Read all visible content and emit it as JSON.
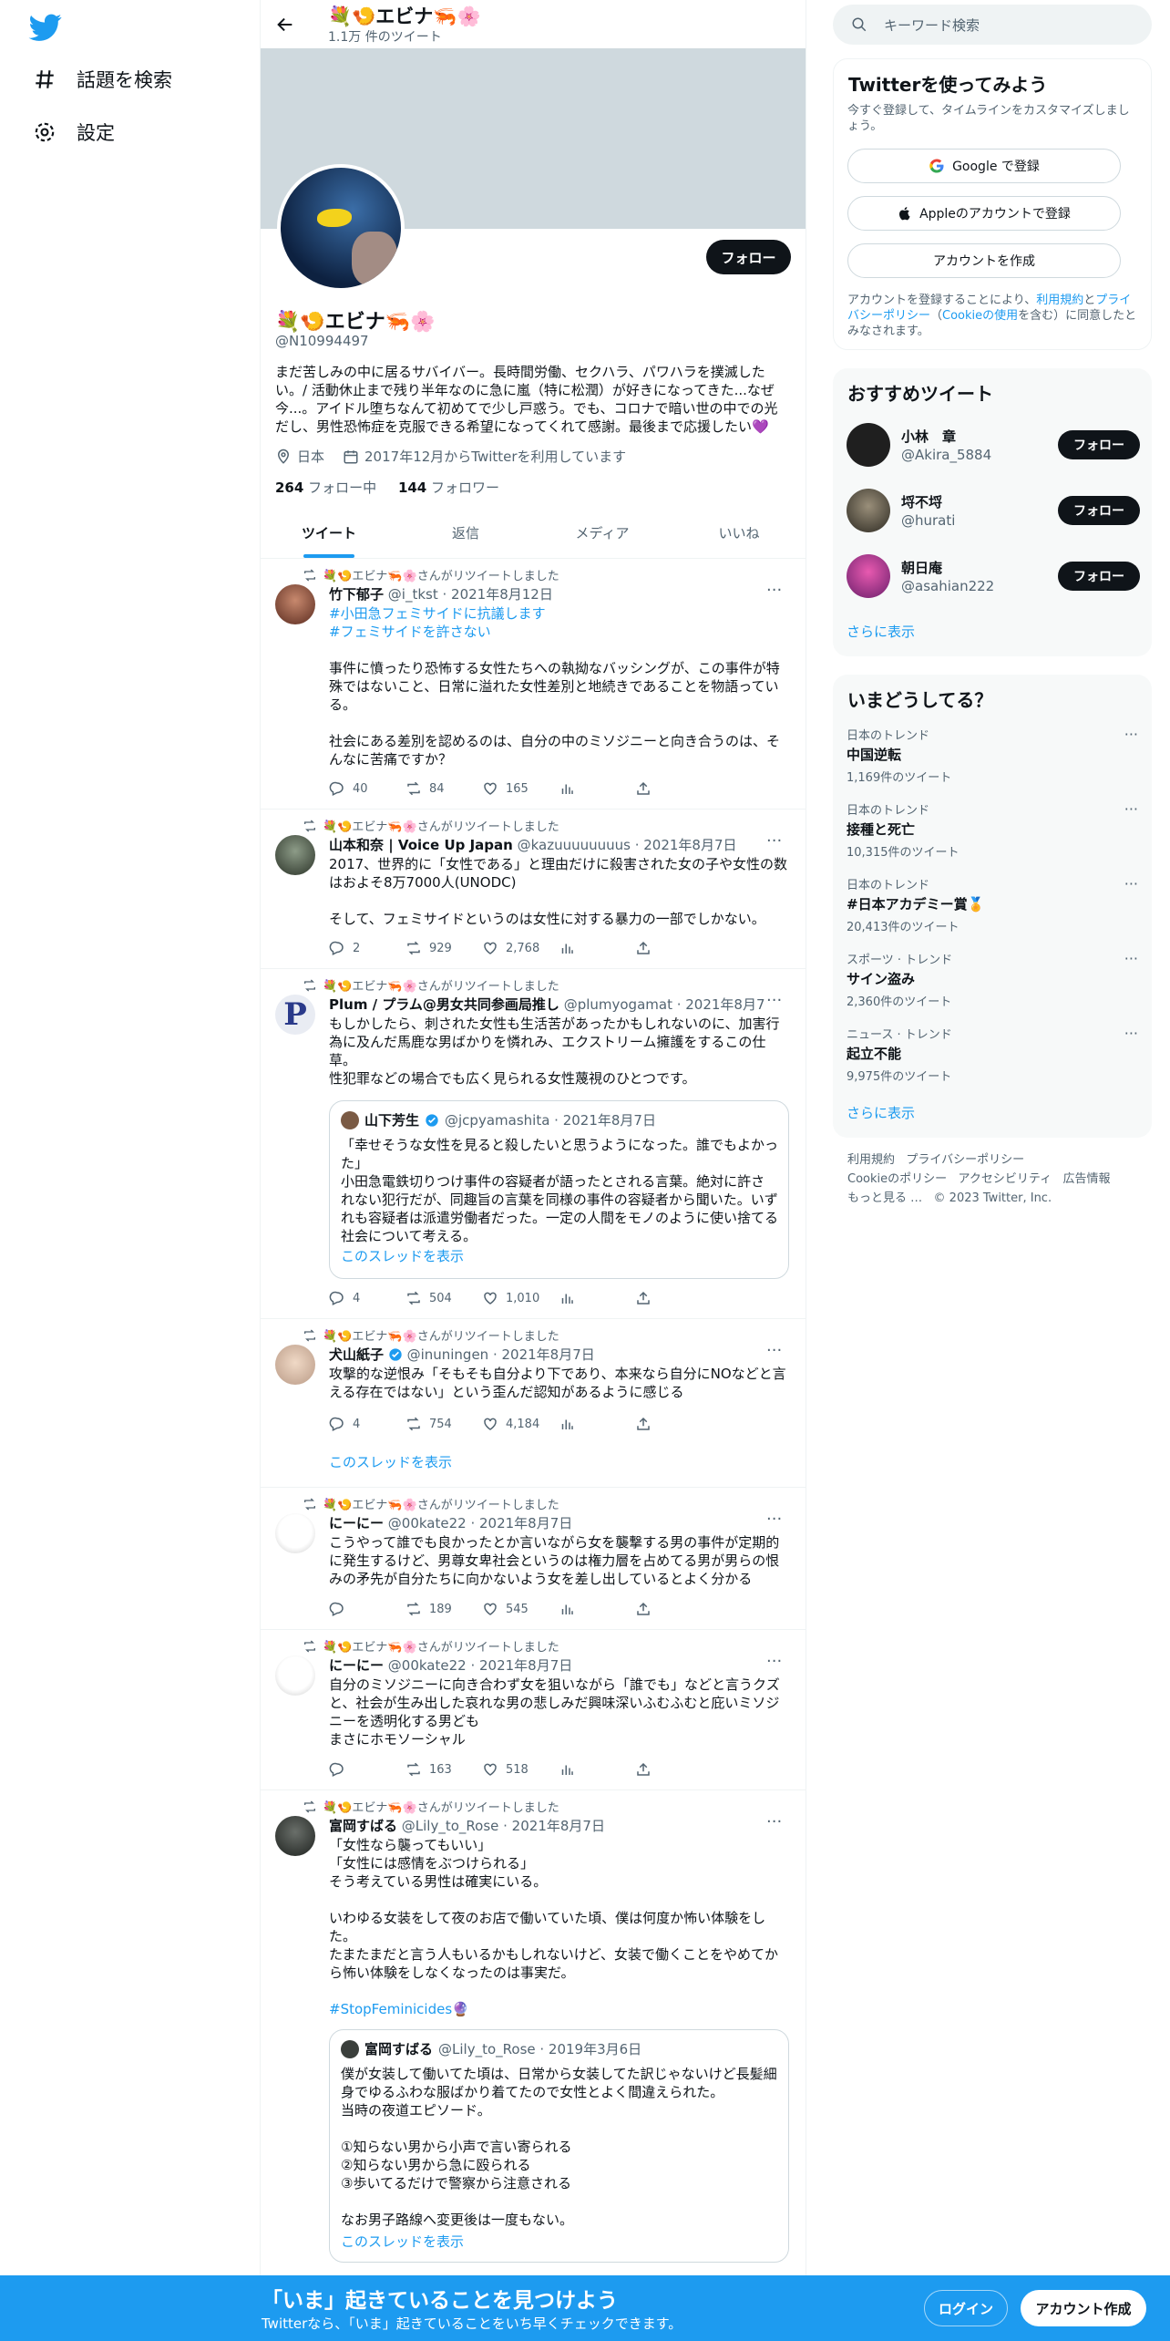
{
  "nav": {
    "explore": "話題を検索",
    "settings": "設定"
  },
  "header": {
    "name": "💐🍤エビナ🦐🌸",
    "tweet_count": "1.1万 件のツイート"
  },
  "profile": {
    "follow_label": "フォロー",
    "name": "💐🍤エビナ🦐🌸",
    "handle": "@N10994497",
    "bio": "まだ苦しみの中に居るサバイバー。長時間労働、セクハラ、パワハラを撲滅したい。/ 活動休止まで残り半年なのに急に嵐（特に松潤）が好きになってきた...なぜ今...。アイドル堕ちなんて初めてで少し戸惑う。でも、コロナで暗い世の中での光だし、男性恐怖症を克服できる希望になってくれて感謝。最後まで応援したい💜",
    "location": "日本",
    "joined": "2017年12月からTwitterを利用しています",
    "following_count": "264",
    "following_label": " フォロー中",
    "followers_count": "144",
    "followers_label": " フォロワー"
  },
  "tabs": [
    "ツイート",
    "返信",
    "メディア",
    "いいね"
  ],
  "retweet_label": "💐🍤エビナ🦐🌸さんがリツイートしました",
  "tweets": [
    {
      "name": "竹下郁子",
      "meta": " @i_tkst · 2021年8月12日",
      "tags": "#小田急フェミサイドに抗議します\n#フェミサイドを許さない",
      "text": "事件に憤ったり恐怖する女性たちへの執拗なバッシングが、この事件が特殊ではないこと、日常に溢れた女性差別と地続きであることを物語っている。\n\n社会にある差別を認めるのは、自分の中のミソジニーと向き合うのは、そんなに苦痛ですか？",
      "reply": "40",
      "rt": "84",
      "like": "165"
    },
    {
      "name": "山本和奈 | Voice Up Japan",
      "meta": " @kazuuuuuuuus · 2021年8月7日",
      "text": "2017、世界的に「女性である」と理由だけに殺害された女の子や女性の数はおよそ8万7000人(UNODC)\n\nそして、フェミサイドというのは女性に対する暴力の一部でしかない。",
      "reply": "2",
      "rt": "929",
      "like": "2,768"
    },
    {
      "name": "Plum / プラム@男女共同参画局推し",
      "meta": " @plumyogamat · 2021年8月7日",
      "text": "もしかしたら、刺された女性も生活苦があったかもしれないのに、加害行為に及んだ馬鹿な男ばかりを憐れみ、エクストリーム擁護をするこの仕草。\n性犯罪などの場合でも広く見られる女性蔑視のひとつです。",
      "quote": {
        "name": "山下芳生",
        "meta": "@jcpyamashita · 2021年8月7日",
        "text": "「幸せそうな女性を見ると殺したいと思うようになった。誰でもよかった」\n小田急電鉄切りつけ事件の容疑者が語ったとされる言葉。絶対に許されない犯行だが、同趣旨の言葉を同様の事件の容疑者から聞いた。いずれも容疑者は派遣労働者だった。一定の人間をモノのように使い捨てる社会について考える。",
        "thread": "このスレッドを表示"
      },
      "reply": "4",
      "rt": "504",
      "like": "1,010"
    },
    {
      "name": "犬山紙子",
      "meta": " @inuningen · 2021年8月7日",
      "text": "攻撃的な逆恨み「そもそも自分より下であり、本来なら自分にNOなどと言える存在ではない」という歪んだ認知があるように感じる",
      "reply": "4",
      "rt": "754",
      "like": "4,184",
      "thread": "このスレッドを表示"
    },
    {
      "name": "にーにー",
      "meta": " @00kate22 · 2021年8月7日",
      "text": "こうやって誰でも良かったとか言いながら女を襲撃する男の事件が定期的に発生するけど、男尊女卑社会というのは権力層を占めてる男が男らの恨みの矛先が自分たちに向かないよう女を差し出しているとよく分かる",
      "reply": "",
      "rt": "189",
      "like": "545"
    },
    {
      "name": "にーにー",
      "meta": " @00kate22 · 2021年8月7日",
      "text": "自分のミソジニーに向き合わず女を狙いながら「誰でも」などと言うクズと、社会が生み出した哀れな男の悲しみだ興味深いふむふむと庇いミソジニーを透明化する男ども\nまさにホモソーシャル",
      "reply": "",
      "rt": "163",
      "like": "518"
    },
    {
      "name": "富岡すばる",
      "meta": " @Lily_to_Rose · 2021年8月7日",
      "text": "「女性なら襲ってもいい」\n「女性には感情をぶつけられる」\nそう考えている男性は確実にいる。\n\nいわゆる女装をして夜のお店で働いていた頃、僕は何度か怖い体験をした。\nたまたまだと言う人もいるかもしれないけど、女装で働くことをやめてから怖い体験をしなくなったのは事実だ。",
      "tag": "#StopFeminicides🔮",
      "quote": {
        "name": "富岡すばる",
        "meta": "@Lily_to_Rose · 2019年3月6日",
        "text": "僕が女装して働いてた頃は、日常から女装してた訳じゃないけど長髪細身でゆるふわな服ばかり着てたので女性とよく間違えられた。\n当時の夜道エピソード。\n\n①知らない男から小声で言い寄られる\n②知らない男から急に殴られる\n③歩いてるだけで警察から注意される\n\nなお男子路線へ変更後は一度もない。",
        "thread": "このスレッドを表示"
      }
    }
  ],
  "search": {
    "placeholder": "キーワード検索"
  },
  "signup": {
    "title": "Twitterを使ってみよう",
    "subtitle": "今すぐ登録して、タイムラインをカスタマイズしましょう。",
    "google": "Google で登録",
    "apple": "Appleのアカウントで登録",
    "create": "アカウントを作成",
    "terms_pre": "アカウントを登録することにより、",
    "terms_link1": "利用規約",
    "terms_mid": "と",
    "terms_link2": "プライバシーポリシー",
    "terms_paren": "（",
    "terms_link3": "Cookieの使用",
    "terms_post": "を含む）に同意したとみなされます。"
  },
  "recommend": {
    "title": "おすすめツイート",
    "users": [
      {
        "name": "小林　章",
        "handle": "@Akira_5884"
      },
      {
        "name": "埒不埒",
        "handle": "@hurati"
      },
      {
        "name": "朝日庵",
        "handle": "@asahian222"
      }
    ],
    "follow_label": "フォロー",
    "more": "さらに表示"
  },
  "trends": {
    "title": "いまどうしてる？",
    "items": [
      {
        "cat": "日本のトレンド",
        "name": "中国逆転",
        "count": "1,169件のツイート"
      },
      {
        "cat": "日本のトレンド",
        "name": "接種と死亡",
        "count": "10,315件のツイート"
      },
      {
        "cat": "日本のトレンド",
        "name": "#日本アカデミー賞🏅",
        "count": "20,413件のツイート"
      },
      {
        "cat": "スポーツ · トレンド",
        "name": "サイン盗み",
        "count": "2,360件のツイート"
      },
      {
        "cat": "ニュース · トレンド",
        "name": "起立不能",
        "count": "9,975件のツイート"
      }
    ],
    "more": "さらに表示"
  },
  "footer": {
    "l1": "利用規約",
    "l2": "プライバシーポリシー",
    "l3": "Cookieのポリシー",
    "l4": "アクセシビリティ",
    "l5": "広告情報",
    "l6": "もっと見る …",
    "l7": "© 2023 Twitter, Inc."
  },
  "bottom": {
    "title": "「いま」起きていることを見つけよう",
    "subtitle": "Twitterなら、「いま」起きていることをいち早くチェックできます。",
    "login": "ログイン",
    "signup": "アカウント作成"
  },
  "colors": {
    "accent": "#1d9bf0",
    "text": "#0f1419",
    "muted": "#536471"
  }
}
